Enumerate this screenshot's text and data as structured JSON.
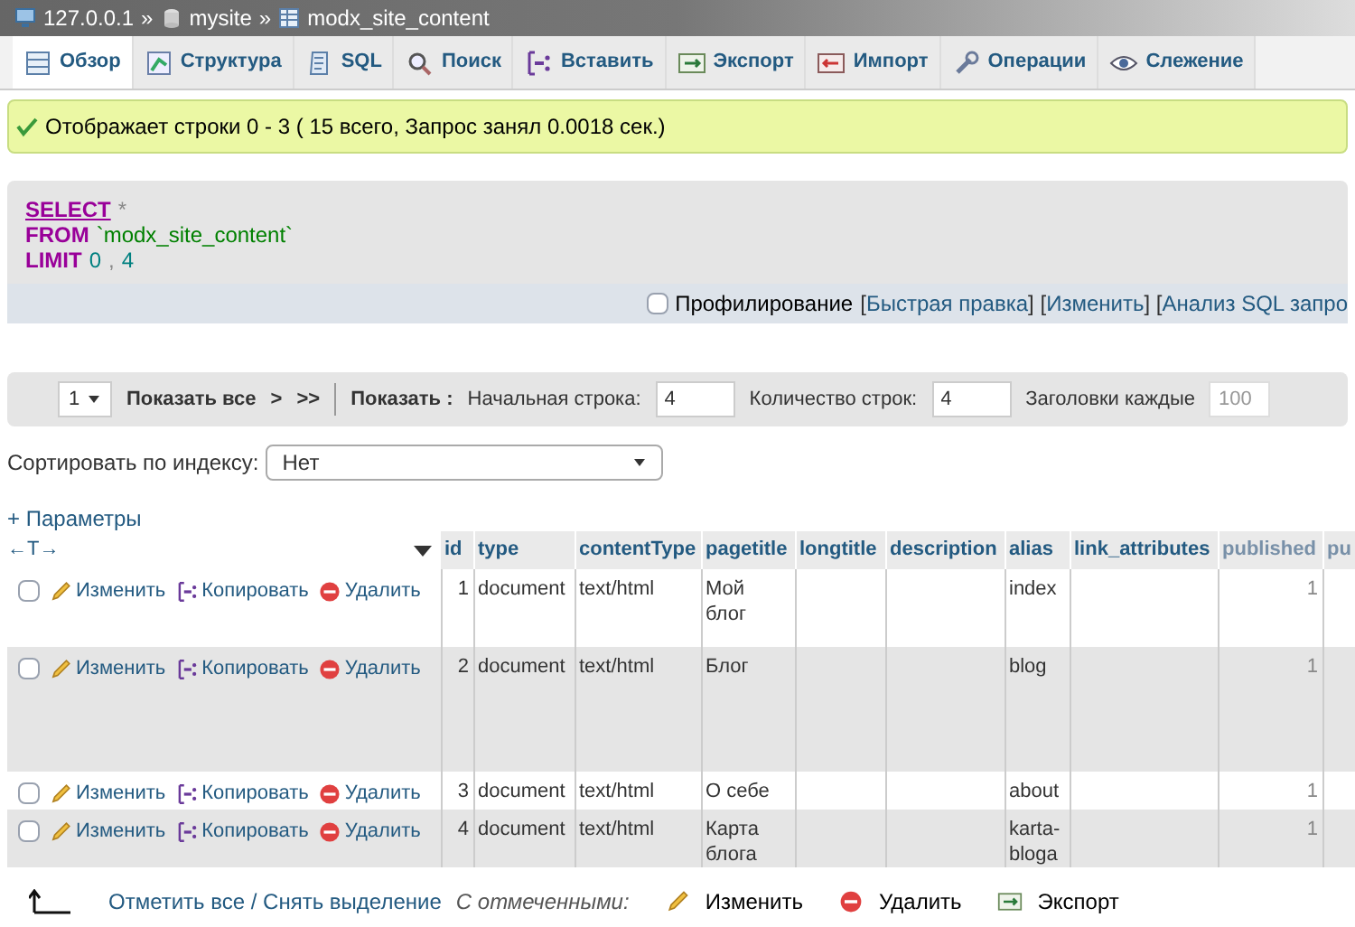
{
  "breadcrumb": {
    "separator": "»",
    "items": [
      {
        "kind": "server",
        "label": "127.0.0.1"
      },
      {
        "kind": "database",
        "label": "mysite"
      },
      {
        "kind": "table",
        "label": "modx_site_content"
      }
    ]
  },
  "tabs": [
    {
      "kind": "browse",
      "label": "Обзор",
      "selected": true
    },
    {
      "kind": "structure",
      "label": "Структура",
      "selected": false
    },
    {
      "kind": "sql",
      "label": "SQL",
      "selected": false
    },
    {
      "kind": "search",
      "label": "Поиск",
      "selected": false
    },
    {
      "kind": "insert",
      "label": "Вставить",
      "selected": false
    },
    {
      "kind": "export",
      "label": "Экспорт",
      "selected": false
    },
    {
      "kind": "import",
      "label": "Импорт",
      "selected": false
    },
    {
      "kind": "operations",
      "label": "Операции",
      "selected": false
    },
    {
      "kind": "tracking",
      "label": "Слежение",
      "selected": false
    }
  ],
  "message": "Отображает строки 0 - 3 ( 15 всего, Запрос занял 0.0018 сек.)",
  "sql": [
    [
      {
        "kind": "keyword-link",
        "text": "SELECT"
      },
      {
        "kind": "operator",
        "text": "*"
      }
    ],
    [
      {
        "kind": "keyword",
        "text": "FROM"
      },
      {
        "kind": "string",
        "text": "`modx_site_content`"
      }
    ],
    [
      {
        "kind": "keyword",
        "text": "LIMIT"
      },
      {
        "kind": "number",
        "text": "0"
      },
      {
        "kind": "operator",
        "text": ","
      },
      {
        "kind": "number",
        "text": "4"
      }
    ]
  ],
  "sql_options": {
    "profiling": {
      "label": "Профилирование",
      "checked": false
    },
    "segments": [
      {
        "kind": "text",
        "text": "["
      },
      {
        "kind": "link",
        "text": "Быстрая правка"
      },
      {
        "kind": "text",
        "text": "] ["
      },
      {
        "kind": "link",
        "text": "Изменить"
      },
      {
        "kind": "text",
        "text": "] ["
      },
      {
        "kind": "link",
        "text": "Анализ SQL запро"
      }
    ]
  },
  "navigation": {
    "page": "1",
    "show_all": "Показать все",
    "next": ">",
    "last": ">>",
    "show_label": "Показать :",
    "start_label": "Начальная строка:",
    "start_value": "4",
    "count_label": "Количество строк:",
    "count_value": "4",
    "headers_label": "Заголовки каждые",
    "headers_value": "100"
  },
  "sort": {
    "label": "Сортировать по индексу:",
    "value": "Нет"
  },
  "options_link": "+ Параметры",
  "table": {
    "arrows": "←T→",
    "columns": [
      "id",
      "type",
      "contentType",
      "pagetitle",
      "longtitle",
      "description",
      "alias",
      "link_attributes",
      "published",
      "pu"
    ],
    "rows": [
      {
        "checked": false,
        "actions": [
          {
            "kind": "edit",
            "label": "Изменить"
          },
          {
            "kind": "copy",
            "label": "Копировать"
          },
          {
            "kind": "delete",
            "label": "Удалить"
          }
        ],
        "cells": [
          "1",
          "document",
          "text/html",
          "Мой блог",
          "",
          "",
          "index",
          "",
          "1"
        ]
      },
      {
        "checked": false,
        "actions": [
          {
            "kind": "edit",
            "label": "Изменить"
          },
          {
            "kind": "copy",
            "label": "Копировать"
          },
          {
            "kind": "delete",
            "label": "Удалить"
          }
        ],
        "cells": [
          "2",
          "document",
          "text/html",
          "Блог",
          "",
          "",
          "blog",
          "",
          "1"
        ]
      },
      {
        "checked": false,
        "actions": [
          {
            "kind": "edit",
            "label": "Изменить"
          },
          {
            "kind": "copy",
            "label": "Копировать"
          },
          {
            "kind": "delete",
            "label": "Удалить"
          }
        ],
        "cells": [
          "3",
          "document",
          "text/html",
          "О себе",
          "",
          "",
          "about",
          "",
          "1"
        ]
      },
      {
        "checked": false,
        "actions": [
          {
            "kind": "edit",
            "label": "Изменить"
          },
          {
            "kind": "copy",
            "label": "Копировать"
          },
          {
            "kind": "delete",
            "label": "Удалить"
          }
        ],
        "cells": [
          "4",
          "document",
          "text/html",
          "Карта блога",
          "",
          "",
          "karta-bloga",
          "",
          "1"
        ]
      }
    ]
  },
  "footer": {
    "check_all": "Отметить все / Снять выделение",
    "with_selected": "С отмеченными:",
    "actions": [
      {
        "kind": "edit",
        "label": "Изменить"
      },
      {
        "kind": "delete",
        "label": "Удалить"
      },
      {
        "kind": "export",
        "label": "Экспорт"
      }
    ]
  }
}
